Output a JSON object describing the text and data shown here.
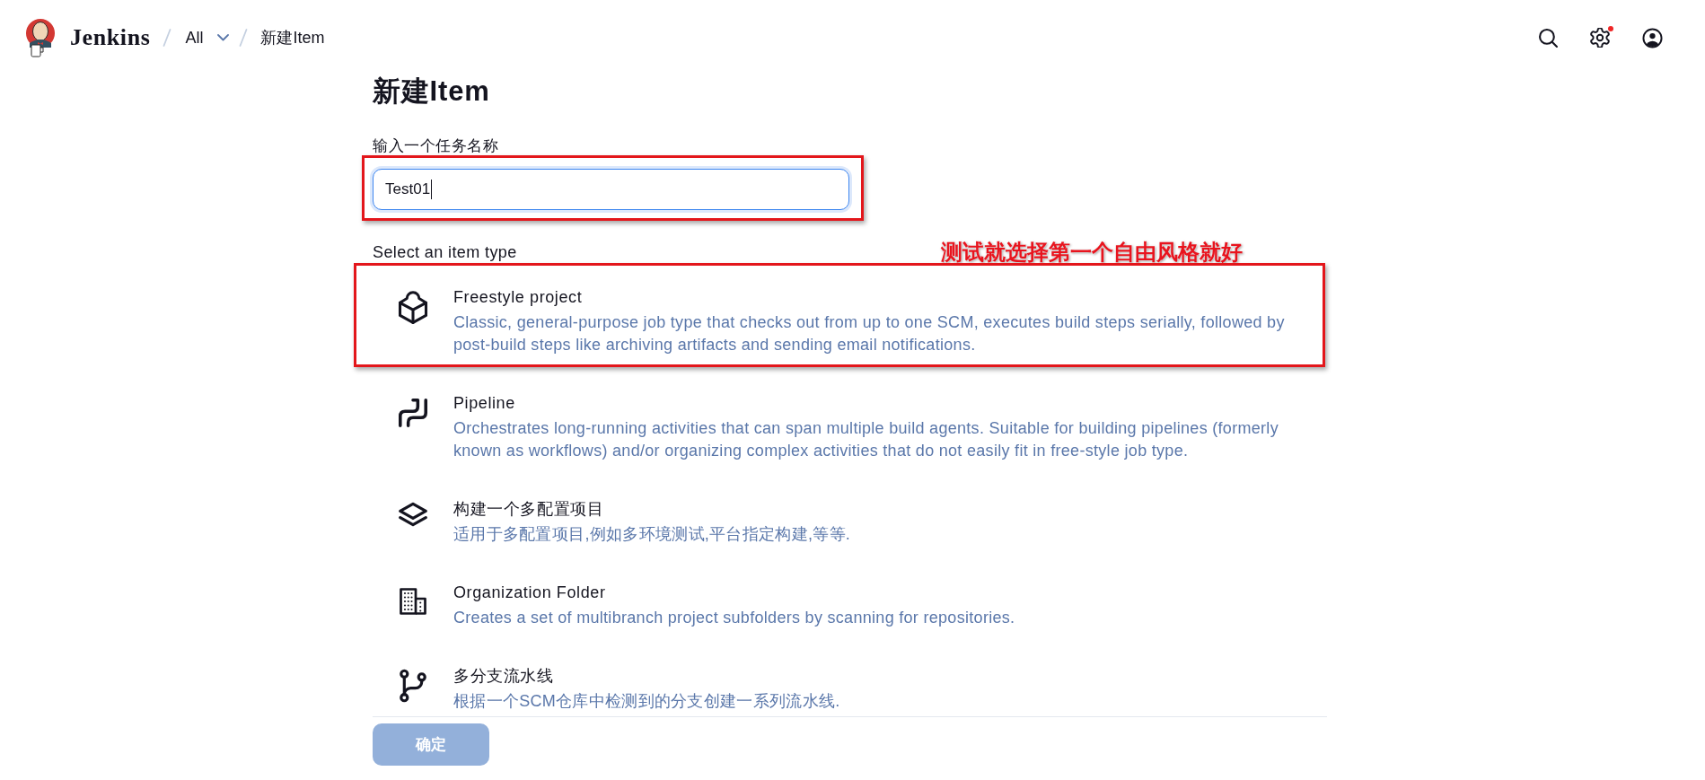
{
  "header": {
    "brand": "Jenkins",
    "breadcrumbs": [
      {
        "label": "All",
        "dropdown": true
      },
      {
        "label": "新建Item",
        "dropdown": false
      }
    ],
    "settings_alert": true
  },
  "page_title": "新建Item",
  "name_field": {
    "label": "输入一个任务名称",
    "value": "Test01",
    "focused": true,
    "annotated": true
  },
  "item_types": {
    "heading": "Select an item type",
    "note": "测试就选择第一个自由风格就好",
    "items": [
      {
        "kind": "freestyle",
        "title": "Freestyle project",
        "description": "Classic, general-purpose job type that checks out from up to one SCM, executes build steps serially, followed by post-build steps like archiving artifacts and sending email notifications.",
        "selected": false,
        "annotated": true
      },
      {
        "kind": "pipeline",
        "title": "Pipeline",
        "description": "Orchestrates long-running activities that can span multiple build agents. Suitable for building pipelines (formerly known as workflows) and/or organizing complex activities that do not easily fit in free-style job type.",
        "selected": false,
        "annotated": false
      },
      {
        "kind": "multiconfig",
        "title": "构建一个多配置项目",
        "description": "适用于多配置项目,例如多环境测试,平台指定构建,等等.",
        "selected": false,
        "annotated": false
      },
      {
        "kind": "organization",
        "title": "Organization Folder",
        "description": "Creates a set of multibranch project subfolders by scanning for repositories.",
        "selected": false,
        "annotated": false
      },
      {
        "kind": "multibranch",
        "title": "多分支流水线",
        "description": "根据一个SCM仓库中检测到的分支创建一系列流水线.",
        "selected": false,
        "annotated": false
      }
    ]
  },
  "submit_button": {
    "label": "确定",
    "disabled": true
  }
}
